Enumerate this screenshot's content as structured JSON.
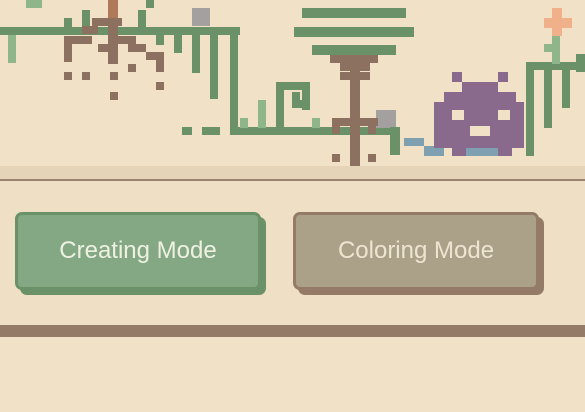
{
  "modes": {
    "creating_label": "Creating Mode",
    "coloring_label": "Coloring Mode"
  },
  "colors": {
    "background": "#f1e2c7",
    "plant_green": "#6a9168",
    "root_brown": "#8c7060",
    "monster_purple": "#8a6a8c",
    "creating_button": "#84a884",
    "coloring_button": "#aba189",
    "water_blue": "#7ea0b0",
    "flower_orange": "#f0b08a"
  }
}
